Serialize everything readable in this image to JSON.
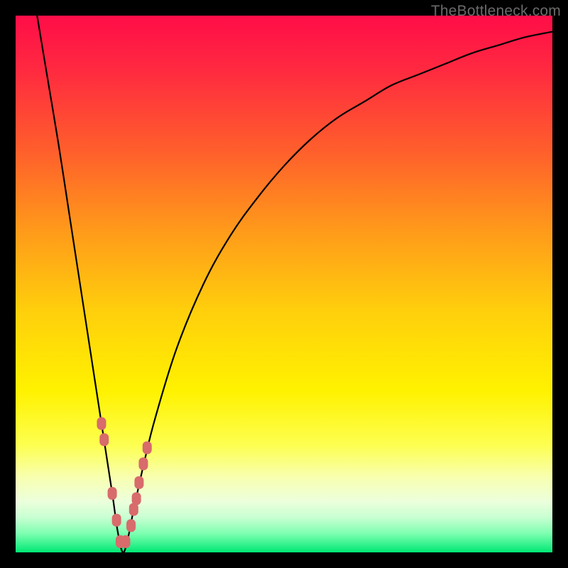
{
  "watermark": "TheBottleneck.com",
  "chart_data": {
    "type": "line",
    "title": "",
    "xlabel": "",
    "ylabel": "",
    "xlim": [
      0,
      100
    ],
    "ylim": [
      0,
      100
    ],
    "minimum_x": 20,
    "series": [
      {
        "name": "bottleneck-curve",
        "x": [
          4,
          6,
          8,
          10,
          12,
          14,
          16,
          18,
          19,
          20,
          21,
          22,
          24,
          26,
          30,
          35,
          40,
          45,
          50,
          55,
          60,
          65,
          70,
          75,
          80,
          85,
          90,
          95,
          100
        ],
        "values": [
          100,
          88,
          76,
          63,
          50,
          37,
          24,
          11,
          4,
          0,
          3,
          8,
          17,
          25,
          38,
          50,
          59,
          66,
          72,
          77,
          81,
          84,
          87,
          89,
          91,
          93,
          94.5,
          96,
          97
        ]
      }
    ],
    "markers": {
      "name": "highlighted-points",
      "color": "#d86b6b",
      "x": [
        16.0,
        16.5,
        18.0,
        18.8,
        19.5,
        20.5,
        21.5,
        22.0,
        22.5,
        23.0,
        23.8,
        24.5
      ],
      "values": [
        24.0,
        21.0,
        11.0,
        6.0,
        2.0,
        2.0,
        5.0,
        8.0,
        10.0,
        13.0,
        16.5,
        19.5
      ]
    },
    "gradient_stops": [
      {
        "offset": 0.0,
        "color": "#ff0d48"
      },
      {
        "offset": 0.1,
        "color": "#ff2940"
      },
      {
        "offset": 0.25,
        "color": "#ff5e2c"
      },
      {
        "offset": 0.4,
        "color": "#ff9a1a"
      },
      {
        "offset": 0.55,
        "color": "#ffcf0c"
      },
      {
        "offset": 0.7,
        "color": "#fff200"
      },
      {
        "offset": 0.8,
        "color": "#fdff50"
      },
      {
        "offset": 0.86,
        "color": "#f8ffb0"
      },
      {
        "offset": 0.905,
        "color": "#ecffdc"
      },
      {
        "offset": 0.935,
        "color": "#c8ffd2"
      },
      {
        "offset": 0.965,
        "color": "#7dffb0"
      },
      {
        "offset": 1.0,
        "color": "#00e874"
      }
    ]
  }
}
